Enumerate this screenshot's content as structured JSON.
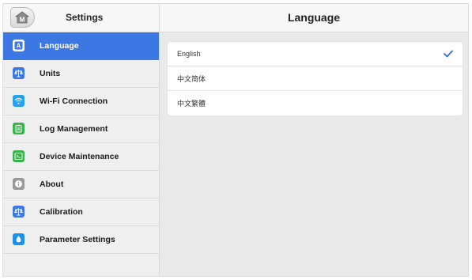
{
  "header": {
    "left_title": "Settings",
    "page_title": "Language",
    "home_button_letter": "M"
  },
  "sidebar": {
    "items": [
      {
        "label": "Language",
        "icon": "language-icon",
        "color": "#3b78e3",
        "active": true
      },
      {
        "label": "Units",
        "icon": "units-icon",
        "color": "#3b78e3",
        "active": false
      },
      {
        "label": "Wi-Fi Connection",
        "icon": "wifi-icon",
        "color": "#26a0e8",
        "active": false
      },
      {
        "label": "Log Management",
        "icon": "clipboard-icon",
        "color": "#37b34a",
        "active": false
      },
      {
        "label": "Device Maintenance",
        "icon": "terminal-icon",
        "color": "#37b34a",
        "active": false
      },
      {
        "label": "About",
        "icon": "info-icon",
        "color": "#9a9a9a",
        "active": false
      },
      {
        "label": "Calibration",
        "icon": "calibration-icon",
        "color": "#3b78e3",
        "active": false
      },
      {
        "label": "Parameter Settings",
        "icon": "drop-icon",
        "color": "#1e90e8",
        "active": false
      }
    ]
  },
  "languages": {
    "options": [
      {
        "label": "English",
        "selected": true
      },
      {
        "label": "中文简体",
        "selected": false
      },
      {
        "label": "中文繁體",
        "selected": false
      }
    ]
  },
  "colors": {
    "accent": "#3b78e3",
    "check": "#2f6fd6"
  }
}
